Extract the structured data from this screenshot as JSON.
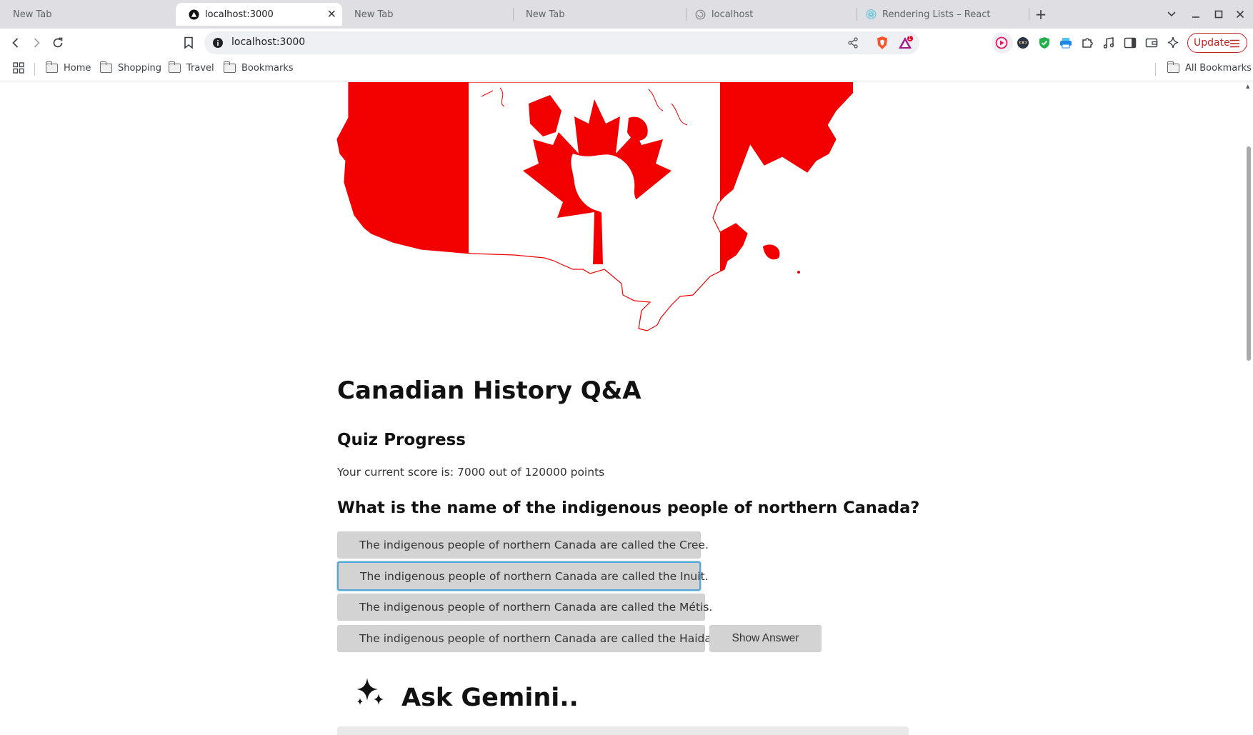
{
  "browser": {
    "tabs": [
      {
        "title": "New Tab",
        "active": false,
        "icon": "none"
      },
      {
        "title": "localhost:3000",
        "active": true,
        "icon": "triangle-logo-icon"
      },
      {
        "title": "New Tab",
        "active": false,
        "icon": "none"
      },
      {
        "title": "New Tab",
        "active": false,
        "icon": "none"
      },
      {
        "title": "localhost",
        "active": false,
        "icon": "loading-icon"
      },
      {
        "title": "Rendering Lists – React",
        "active": false,
        "icon": "react-icon"
      }
    ],
    "url": "localhost:3000",
    "update_label": "Update",
    "bookmarks": [
      "Home",
      "Shopping",
      "Travel",
      "Bookmarks"
    ],
    "all_bookmarks_label": "All Bookmarks",
    "notification_badge": "1"
  },
  "page": {
    "title": "Canadian History Q&A",
    "progress_heading": "Quiz Progress",
    "score_text": "Your current score is: 7000 out of 120000 points",
    "question": "What is the name of the indigenous people of northern Canada?",
    "answers": [
      "The indigenous people of northern Canada are called the Cree.",
      "The indigenous people of northern Canada are called the Inuit.",
      "The indigenous people of northern Canada are called the Métis.",
      "The indigenous people of northern Canada are called the Haida."
    ],
    "show_answer_label": "Show Answer",
    "gemini_title": "Ask Gemini.."
  },
  "colors": {
    "flag_red": "#f20000",
    "focus_ring": "#52a7d6",
    "button_bg": "#d3d3d3"
  }
}
